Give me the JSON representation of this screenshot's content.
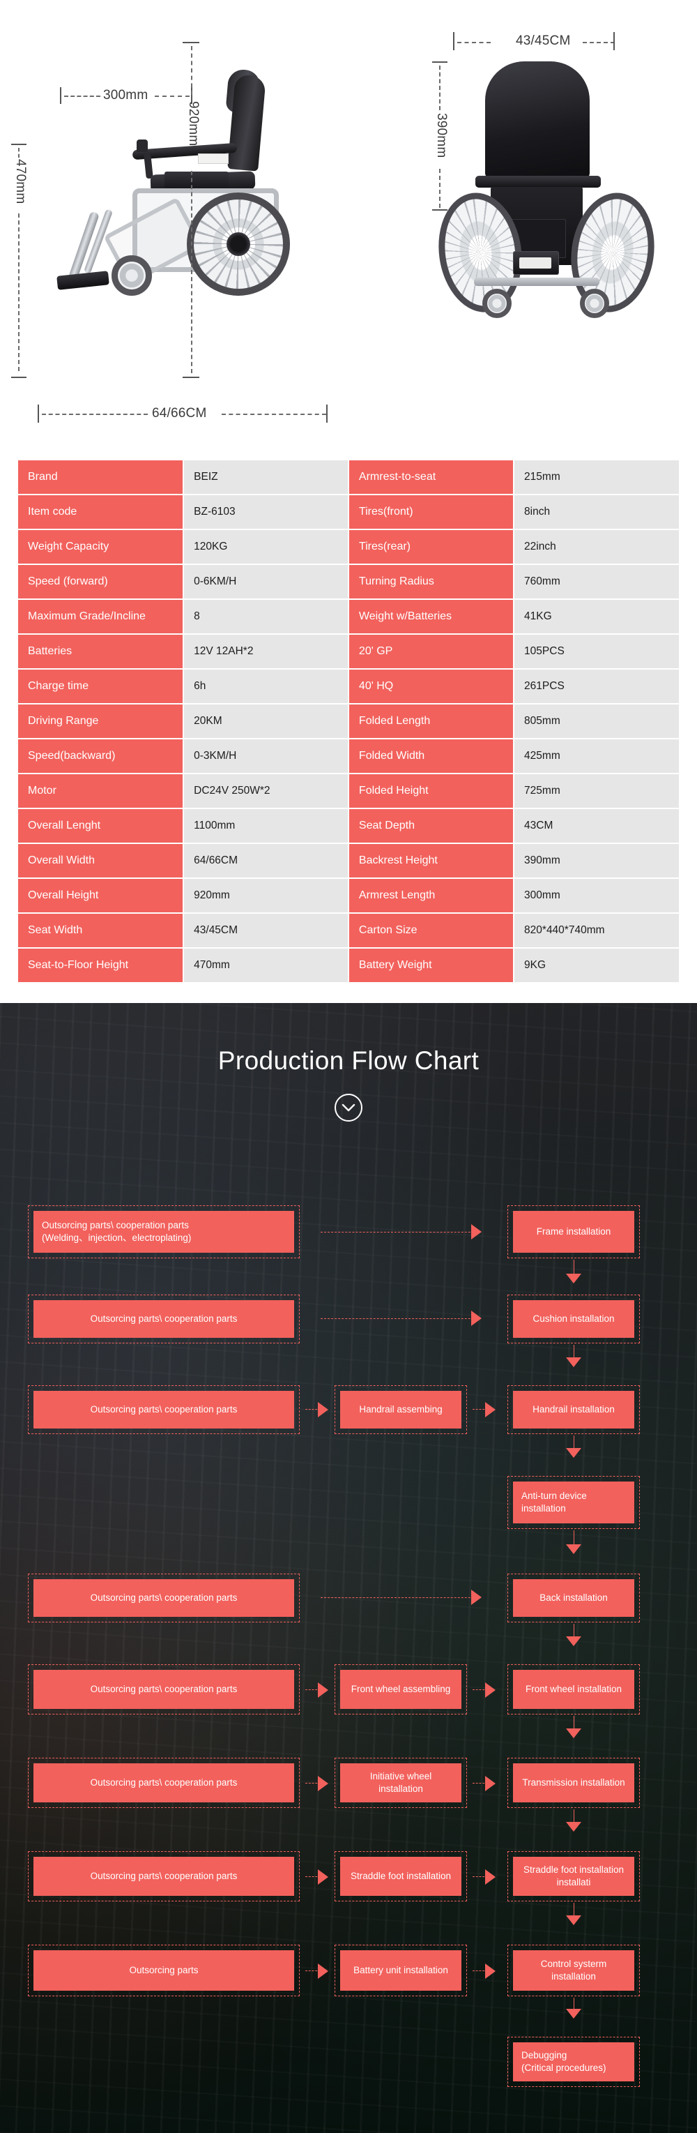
{
  "product": {
    "side_view": {
      "armrest_length_label": "300mm",
      "overall_height_label": "920mm",
      "seat_to_floor_label": "470mm",
      "overall_width_label": "64/66CM"
    },
    "rear_view": {
      "seat_width_label": "43/45CM",
      "backrest_height_label": "390mm"
    }
  },
  "spec_table": {
    "rows": [
      {
        "k1": "Brand",
        "v1": "BEIZ",
        "k2": "Armrest-to-seat",
        "v2": "215mm"
      },
      {
        "k1": "Item code",
        "v1": "BZ-6103",
        "k2": "Tires(front)",
        "v2": "8inch"
      },
      {
        "k1": "Weight Capacity",
        "v1": "120KG",
        "k2": "Tires(rear)",
        "v2": "22inch"
      },
      {
        "k1": "Speed (forward)",
        "v1": "0-6KM/H",
        "k2": "Turning Radius",
        "v2": "760mm"
      },
      {
        "k1": "Maximum Grade/Incline",
        "v1": "8",
        "k2": "Weight w/Batteries",
        "v2": "41KG"
      },
      {
        "k1": "Batteries",
        "v1": "12V 12AH*2",
        "k2": "20'  GP",
        "v2": "105PCS"
      },
      {
        "k1": "Charge time",
        "v1": "6h",
        "k2": "40'  HQ",
        "v2": "261PCS"
      },
      {
        "k1": "Driving Range",
        "v1": "20KM",
        "k2": "Folded Length",
        "v2": "805mm"
      },
      {
        "k1": "Speed(backward)",
        "v1": "0-3KM/H",
        "k2": "Folded Width",
        "v2": "425mm"
      },
      {
        "k1": "Motor",
        "v1": "DC24V 250W*2",
        "k2": "Folded Height",
        "v2": "725mm"
      },
      {
        "k1": "Overall Lenght",
        "v1": "1100mm",
        "k2": "Seat Depth",
        "v2": "43CM"
      },
      {
        "k1": "Overall Width",
        "v1": "64/66CM",
        "k2": "Backrest Height",
        "v2": "390mm"
      },
      {
        "k1": "Overall Height",
        "v1": "920mm",
        "k2": "Armrest Length",
        "v2": "300mm"
      },
      {
        "k1": "Seat  Width",
        "v1": "43/45CM",
        "k2": "Carton Size",
        "v2": "820*440*740mm"
      },
      {
        "k1": "Seat-to-Floor Height",
        "v1": "470mm",
        "k2": "Battery Weight",
        "v2": "9KG"
      }
    ]
  },
  "flow": {
    "title": "Production Flow Chart",
    "scroll_icon": "chevron-down-icon",
    "accent_color": "#f2615c",
    "nodes": {
      "n1": "Outsorcing parts\\ cooperation parts\n(Welding、injection、electroplating)",
      "n2": "Frame installation",
      "n3": "Outsorcing parts\\ cooperation parts",
      "n4": "Cushion installation",
      "n5": "Outsorcing parts\\ cooperation parts",
      "n6": "Handrail assembing",
      "n7": "Handrail installation",
      "n8": "Anti-turn device installation",
      "n9": "Outsorcing parts\\ cooperation parts",
      "n10": "Back installation",
      "n11": "Outsorcing parts\\ cooperation parts",
      "n12": "Front wheel assembling",
      "n13": "Front wheel installation",
      "n14": "Outsorcing parts\\ cooperation parts",
      "n15": "Initiative wheel installation",
      "n16": "Transmission installation",
      "n17": "Outsorcing parts\\ cooperation parts",
      "n18": "Straddle foot installation",
      "n19": "Straddle foot installation installati",
      "n20": "Outsorcing parts",
      "n21": "Battery unit installation",
      "n22": "Control systerm installation",
      "n23": "Debugging\n(Critical procedures)"
    }
  }
}
